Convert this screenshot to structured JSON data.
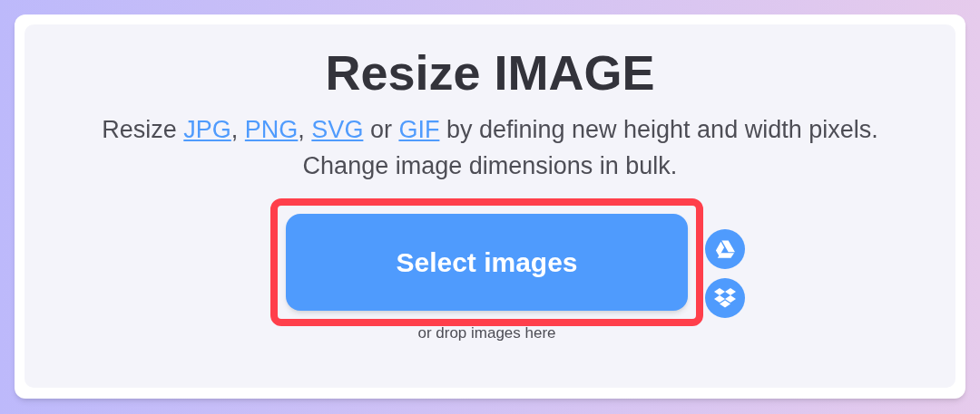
{
  "title": "Resize IMAGE",
  "description": [
    [
      {
        "kind": "text",
        "text": "Resize "
      },
      {
        "kind": "link",
        "text": "JPG"
      },
      {
        "kind": "text",
        "text": ", "
      },
      {
        "kind": "link",
        "text": "PNG"
      },
      {
        "kind": "text",
        "text": ", "
      },
      {
        "kind": "link",
        "text": "SVG"
      },
      {
        "kind": "text",
        "text": " or "
      },
      {
        "kind": "link",
        "text": "GIF"
      },
      {
        "kind": "text",
        "text": " by defining new height and width pixels."
      }
    ],
    [
      {
        "kind": "text",
        "text": "Change image dimensions in bulk."
      }
    ]
  ],
  "upload_button": {
    "label": "Select images",
    "highlighted": true
  },
  "side_buttons": [
    {
      "kind": "drive"
    },
    {
      "kind": "dropbox"
    }
  ],
  "drop_hint": "or drop images here"
}
